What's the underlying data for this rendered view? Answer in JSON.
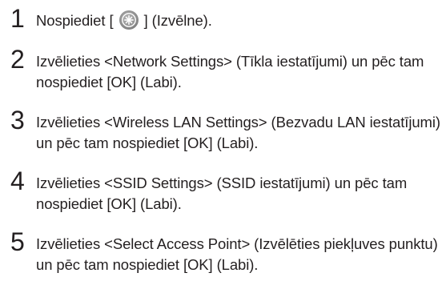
{
  "steps": [
    {
      "number": "1",
      "text_before_icon": "Nospiediet [ ",
      "text_after_icon": " ] (Izvēlne).",
      "icon": "menu-key-icon"
    },
    {
      "number": "2",
      "text": "Izvēlieties <Network Settings> (Tīkla iestatījumi) un pēc tam nospiediet [OK] (Labi)."
    },
    {
      "number": "3",
      "text": "Izvēlieties <Wireless LAN Settings> (Bezvadu LAN iestatījumi) un pēc tam nospiediet [OK] (Labi)."
    },
    {
      "number": "4",
      "text": "Izvēlieties <SSID Settings> (SSID iestatījumi) un pēc tam nospiediet [OK] (Labi)."
    },
    {
      "number": "5",
      "text": "Izvēlieties <Select Access Point> (Izvēlēties piekļuves punktu) un pēc tam nospiediet [OK] (Labi)."
    }
  ]
}
